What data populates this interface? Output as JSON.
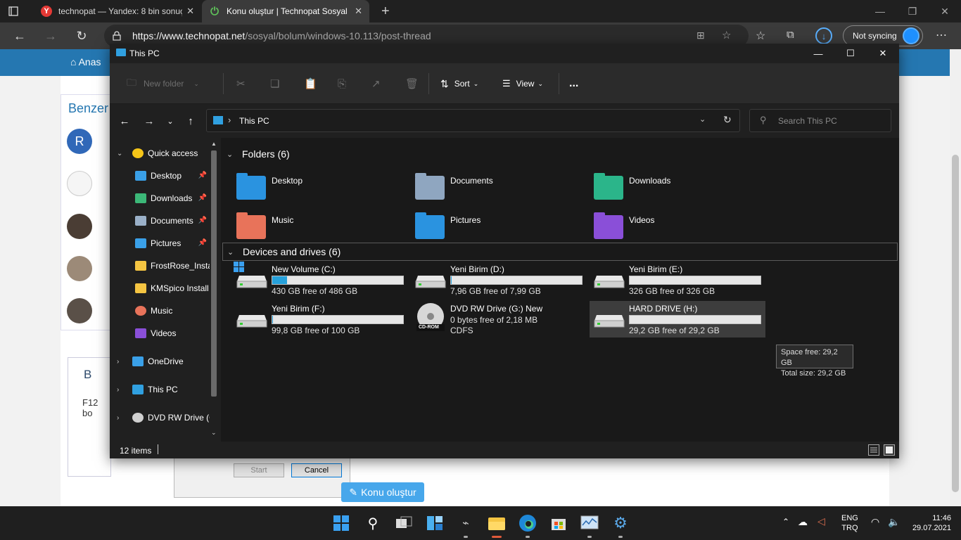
{
  "browser": {
    "tabs": [
      {
        "label": "technopat — Yandex: 8 bin sonuç",
        "fav": "Y"
      },
      {
        "label": "Konu oluştur | Technopat Sosyal",
        "fav": "⏻"
      }
    ],
    "url_host": "https://www.technopat.net",
    "url_path": "/sosyal/bolum/windows-10.113/post-thread",
    "sync_label": "Not syncing"
  },
  "page": {
    "home_label": "Anas",
    "benzer_label": "Benzer",
    "avatar_letter": "R",
    "editor_bold": "B",
    "editor_text": "F12 bo",
    "konu_button": "Konu oluştur",
    "dialog": {
      "start": "Start",
      "cancel": "Cancel"
    }
  },
  "explorer": {
    "title": "This PC",
    "toolbar": {
      "new_folder": "New folder",
      "sort": "Sort",
      "view": "View",
      "more": "..."
    },
    "address": "This PC",
    "search_placeholder": "Search This PC",
    "tree": [
      {
        "label": "Quick access",
        "icon": "star-icon",
        "indent": 0,
        "expand": "expanded",
        "color": "#f5c518"
      },
      {
        "label": "Desktop",
        "icon": "desktop-folder-icon",
        "indent": 1,
        "pinned": true,
        "color": "#3aa0e8"
      },
      {
        "label": "Downloads",
        "icon": "download-arrow-icon",
        "indent": 1,
        "pinned": true,
        "color": "#3cb878"
      },
      {
        "label": "Documents",
        "icon": "documents-icon",
        "indent": 1,
        "pinned": true,
        "color": "#9ab0c8"
      },
      {
        "label": "Pictures",
        "icon": "pictures-icon",
        "indent": 1,
        "pinned": true,
        "color": "#3aa0e8"
      },
      {
        "label": "FrostRose_Insta",
        "icon": "folder-icon",
        "indent": 1,
        "pinned": false,
        "color": "#f5c542"
      },
      {
        "label": "KMSpico Install",
        "icon": "folder-icon",
        "indent": 1,
        "pinned": false,
        "color": "#f5c542"
      },
      {
        "label": "Music",
        "icon": "music-icon",
        "indent": 1,
        "pinned": false,
        "color": "#e8735a"
      },
      {
        "label": "Videos",
        "icon": "videos-icon",
        "indent": 1,
        "pinned": false,
        "color": "#8a4fd8"
      },
      {
        "label": "OneDrive",
        "icon": "cloud-icon",
        "indent": 0,
        "expand": "collapsed",
        "color": "#3aa0e8"
      },
      {
        "label": "This PC",
        "icon": "monitor-icon",
        "indent": 0,
        "expand": "collapsed",
        "color": "#30a0e0"
      },
      {
        "label": "DVD RW Drive (G",
        "icon": "disc-icon",
        "indent": 0,
        "expand": "collapsed",
        "color": "#d0d0d0"
      }
    ],
    "folders_header": "Folders (6)",
    "folders": [
      {
        "label": "Desktop",
        "icon": "desktop-folder-icon",
        "color": "#2a93e0"
      },
      {
        "label": "Documents",
        "icon": "documents-folder-icon",
        "color": "#8fa6c0"
      },
      {
        "label": "Downloads",
        "icon": "downloads-folder-icon",
        "color": "#2bb58a"
      },
      {
        "label": "Music",
        "icon": "music-folder-icon",
        "color": "#e8735a"
      },
      {
        "label": "Pictures",
        "icon": "pictures-folder-icon",
        "color": "#2a93e0"
      },
      {
        "label": "Videos",
        "icon": "videos-folder-icon",
        "color": "#8a4fd8"
      }
    ],
    "drives_header": "Devices and drives (6)",
    "drives": [
      {
        "label": "New Volume (C:)",
        "free": "430 GB free of 486 GB",
        "used_fraction": 0.115,
        "icon": "windows-drive-icon"
      },
      {
        "label": "Yeni Birim (D:)",
        "free": "7,96 GB free of 7,99 GB",
        "used_fraction": 0.004,
        "icon": "hard-drive-icon"
      },
      {
        "label": "Yeni Birim (E:)",
        "free": "326 GB free of 326 GB",
        "used_fraction": 0.0,
        "icon": "hard-drive-icon"
      },
      {
        "label": "Yeni Birim (F:)",
        "free": "99,8 GB free of 100 GB",
        "used_fraction": 0.002,
        "icon": "hard-drive-icon"
      },
      {
        "label": "DVD RW Drive (G:) New",
        "free": "0 bytes free of 2,18 MB",
        "extra": "CDFS",
        "icon": "cd-rom-icon",
        "disc_label": "CD-ROM"
      },
      {
        "label": "HARD DRIVE (H:)",
        "free": "29,2 GB free of 29,2 GB",
        "used_fraction": 0.0,
        "icon": "hard-drive-icon"
      }
    ],
    "tooltip": {
      "line1": "Space free: 29,2 GB",
      "line2": "Total size: 29,2 GB"
    },
    "status": "12 items"
  },
  "taskbar": {
    "lang1": "ENG",
    "lang2": "TRQ",
    "time": "11:46",
    "date": "29.07.2021"
  }
}
